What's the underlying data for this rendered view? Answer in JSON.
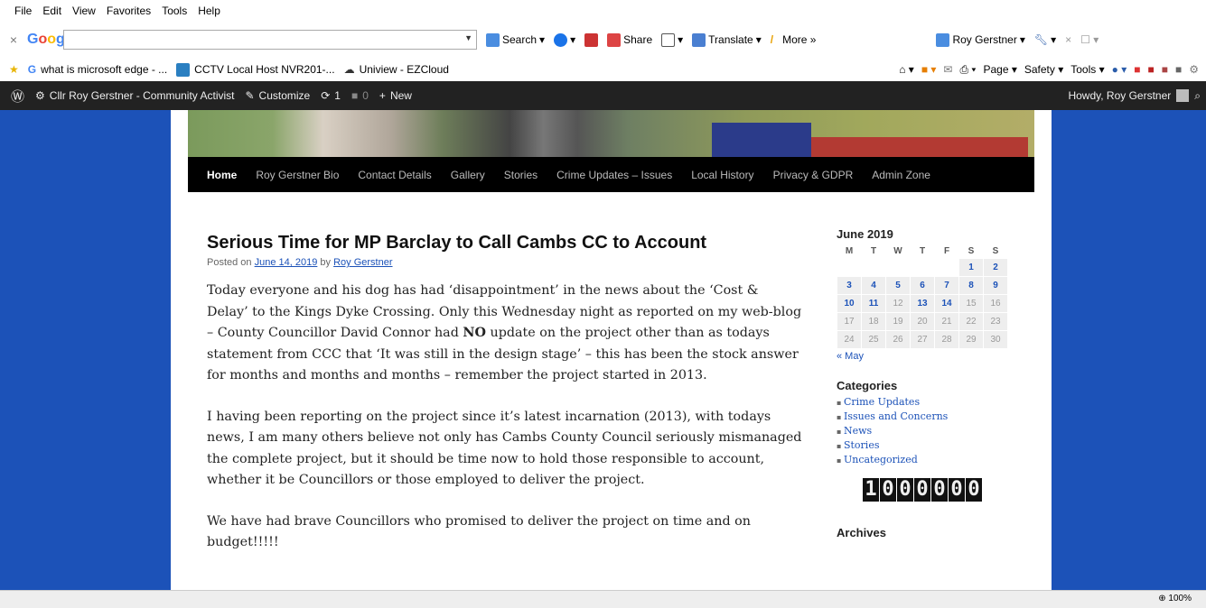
{
  "menu": [
    "File",
    "Edit",
    "View",
    "Favorites",
    "Tools",
    "Help"
  ],
  "googlebar": {
    "logo": "Google",
    "search_label": "Search",
    "share_label": "Share",
    "translate_label": "Translate",
    "more_label": "More »",
    "user_label": "Roy Gerstner"
  },
  "favorites": [
    "what is microsoft edge - ...",
    "CCTV Local Host NVR201-...",
    "Uniview - EZCloud"
  ],
  "commandbar": {
    "page": "Page",
    "safety": "Safety",
    "tools": "Tools"
  },
  "wpbar": {
    "site": "Cllr Roy Gerstner - Community Activist",
    "customize": "Customize",
    "updates": "1",
    "comments": "0",
    "new": "New",
    "howdy": "Howdy, Roy Gerstner"
  },
  "nav": [
    "Home",
    "Roy Gerstner Bio",
    "Contact Details",
    "Gallery",
    "Stories",
    "Crime Updates – Issues",
    "Local History",
    "Privacy & GDPR",
    "Admin Zone"
  ],
  "post": {
    "title": "Serious Time for MP Barclay to Call Cambs CC to Account",
    "posted_on": "Posted on",
    "date": "June 14, 2019",
    "by": "by",
    "author": "Roy Gerstner",
    "p1": "Today everyone and his dog has had ‘disappointment’ in the news about the ‘Cost & Delay’ to the Kings Dyke Crossing. Only this Wednesday night as reported on my web-blog – County Councillor David Connor had NO update on the project other than as todays statement from CCC that ‘It was still in the design stage’ – this has been the stock answer for months and months and months – remember the project started in 2013.",
    "p2": "I having been reporting on the project since it’s latest incarnation (2013), with todays news, I am many others believe not only has Cambs County Council seriously mismanaged the complete project, but it should be time now to hold those responsible to account, whether it be Councillors or those employed to deliver the project.",
    "p3": "We have had brave Councillors who promised to deliver the project on time and on budget!!!!!"
  },
  "calendar": {
    "title": "June 2019",
    "days": [
      "M",
      "T",
      "W",
      "T",
      "F",
      "S",
      "S"
    ],
    "weeks": [
      [
        "",
        "",
        "",
        "",
        "",
        "1",
        "2"
      ],
      [
        "3",
        "4",
        "5",
        "6",
        "7",
        "8",
        "9"
      ],
      [
        "10",
        "11",
        "12",
        "13",
        "14",
        "15",
        "16"
      ],
      [
        "17",
        "18",
        "19",
        "20",
        "21",
        "22",
        "23"
      ],
      [
        "24",
        "25",
        "26",
        "27",
        "28",
        "29",
        "30"
      ]
    ],
    "linked": [
      "1",
      "2",
      "3",
      "4",
      "5",
      "6",
      "7",
      "8",
      "9",
      "10",
      "11",
      "13",
      "14"
    ],
    "prev": "« May"
  },
  "categories": {
    "title": "Categories",
    "items": [
      "Crime Updates",
      "Issues and Concerns",
      "News",
      "Stories",
      "Uncategorized"
    ]
  },
  "counter": "1000000",
  "archives": {
    "title": "Archives"
  },
  "status": {
    "zoom": "100%"
  }
}
